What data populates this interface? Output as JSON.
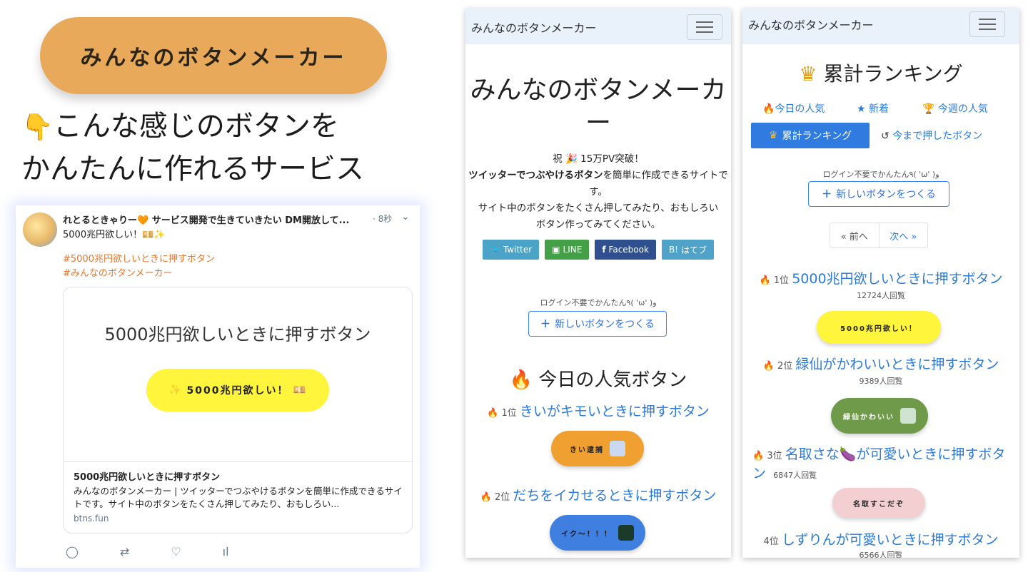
{
  "promo": {
    "pill_label": "みんなのボタンメーカー",
    "line1": "こんな感じのボタンを",
    "line2": "かんたんに作れるサービス"
  },
  "tweet": {
    "header": "れとるときゃりー🧡 サービス開発で生きていきたい DM開放して...",
    "time": "· 8秒",
    "body": "5000兆円欲しい！💴✨",
    "tag1": "#5000兆円欲しいときに押すボタン",
    "tag2": "#みんなのボタンメーカー",
    "card_title": "5000兆円欲しいときに押すボタン",
    "card_button": "5000兆円欲しい！",
    "card_foot_title": "5000兆円欲しいときに押すボタン",
    "card_foot_desc": "みんなのボタンメーカー | ツイッターでつぶやけるボタンを簡単に作成できるサイトです。サイト中のボタンをたくさん押してみたり、おもしろい...",
    "card_url": "btns.fun"
  },
  "phone1": {
    "nav_title": "みんなのボタンメーカー",
    "title": "みんなのボタンメーカー",
    "celebrate": "祝 🎉 15万PV突破！",
    "desc_bold": "ツイッターでつぶやけるボタン",
    "desc1": "を簡単に作成できるサイトです。",
    "desc2": "サイト中のボタンをたくさん押してみたり、おもしろいボタン作ってみてください。",
    "share": [
      "Twitter",
      "LINE",
      "Facebook",
      "はてブ"
    ],
    "login_note": "ログイン不要でかんたん٩( 'ω' )و",
    "new_button": "新しいボタンをつくる",
    "section_title": "今日の人気ボタン",
    "ranks": [
      {
        "rank": "1位",
        "title": "きいがキモいときに押すボタン",
        "button": "きい逮捕"
      },
      {
        "rank": "2位",
        "title": "だちをイカせるときに押すボタン",
        "button": "イク〜！！！"
      }
    ]
  },
  "phone2": {
    "nav_title": "みんなのボタンメーカー",
    "title": "累計ランキング",
    "tabs": {
      "today": "今日の人気",
      "new": "新着",
      "week": "今週の人気",
      "total": "累計ランキング",
      "history": "今まで押したボタン"
    },
    "login_note": "ログイン不要でかんたん٩( 'ω' )و",
    "new_button": "新しいボタンをつくる",
    "pager": {
      "prev": "« 前へ",
      "next": "次へ »"
    },
    "ranks": [
      {
        "rank": "1位",
        "title": "5000兆円欲しいときに押すボタン",
        "views": "12724人回覧",
        "button": "5000兆円欲しい！"
      },
      {
        "rank": "2位",
        "title": "緑仙がかわいいときに押すボタン",
        "views": "9389人回覧",
        "button": "緑仙かわいい"
      },
      {
        "rank": "3位",
        "title": "名取さな🍆が可愛いときに押すボタン",
        "views": "6847人回覧",
        "button": "名取すこだぞ"
      },
      {
        "rank": "4位",
        "title": "しずりんが可愛いときに押すボタン",
        "views": "6566人回覧"
      }
    ]
  },
  "colors": {
    "accent": "#2f7be0",
    "promo_orange": "#e8a95a",
    "yellow": "#fff53d",
    "orange_btn": "#f0a030"
  }
}
